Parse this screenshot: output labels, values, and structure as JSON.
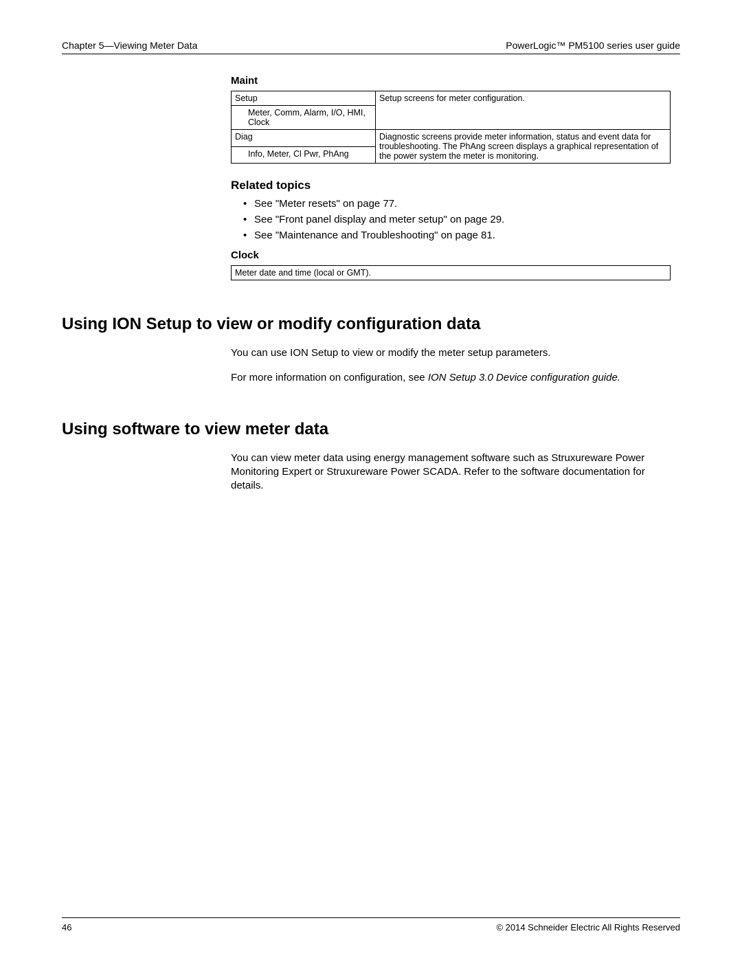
{
  "header": {
    "left": "Chapter 5—Viewing Meter Data",
    "right": "PowerLogic™  PM5100 series user guide"
  },
  "maint": {
    "label": "Maint",
    "rows": [
      {
        "left_top": "Setup",
        "left_sub": "Meter, Comm, Alarm, I/O, HMI, Clock",
        "right": "Setup screens for meter configuration."
      },
      {
        "left_top": "Diag",
        "left_sub": "Info, Meter, Cl Pwr, PhAng",
        "right": "Diagnostic screens provide meter information, status and event data for troubleshooting. The PhAng screen displays a graphical representation of the power system the meter is monitoring."
      }
    ]
  },
  "related": {
    "heading": "Related topics",
    "items": [
      "See \"Meter resets\" on page 77.",
      "See \"Front panel display and meter setup\" on page 29.",
      "See \"Maintenance and Troubleshooting\" on page 81."
    ]
  },
  "clock": {
    "label": "Clock",
    "text": "Meter date and time (local or GMT)."
  },
  "sections": {
    "ion": {
      "heading": "Using ION Setup to view or modify configuration data",
      "p1": "You can use ION Setup to view or modify the meter setup parameters.",
      "p2_prefix": "For more information on configuration, see ",
      "p2_italic": "ION Setup 3.0 Device configuration guide."
    },
    "software": {
      "heading": "Using software to view meter data",
      "p1": "You can view meter data using energy management software such as Struxureware Power Monitoring Expert or Struxureware Power SCADA. Refer to the software documentation for details."
    }
  },
  "footer": {
    "page": "46",
    "copyright": "© 2014 Schneider Electric All Rights Reserved"
  }
}
